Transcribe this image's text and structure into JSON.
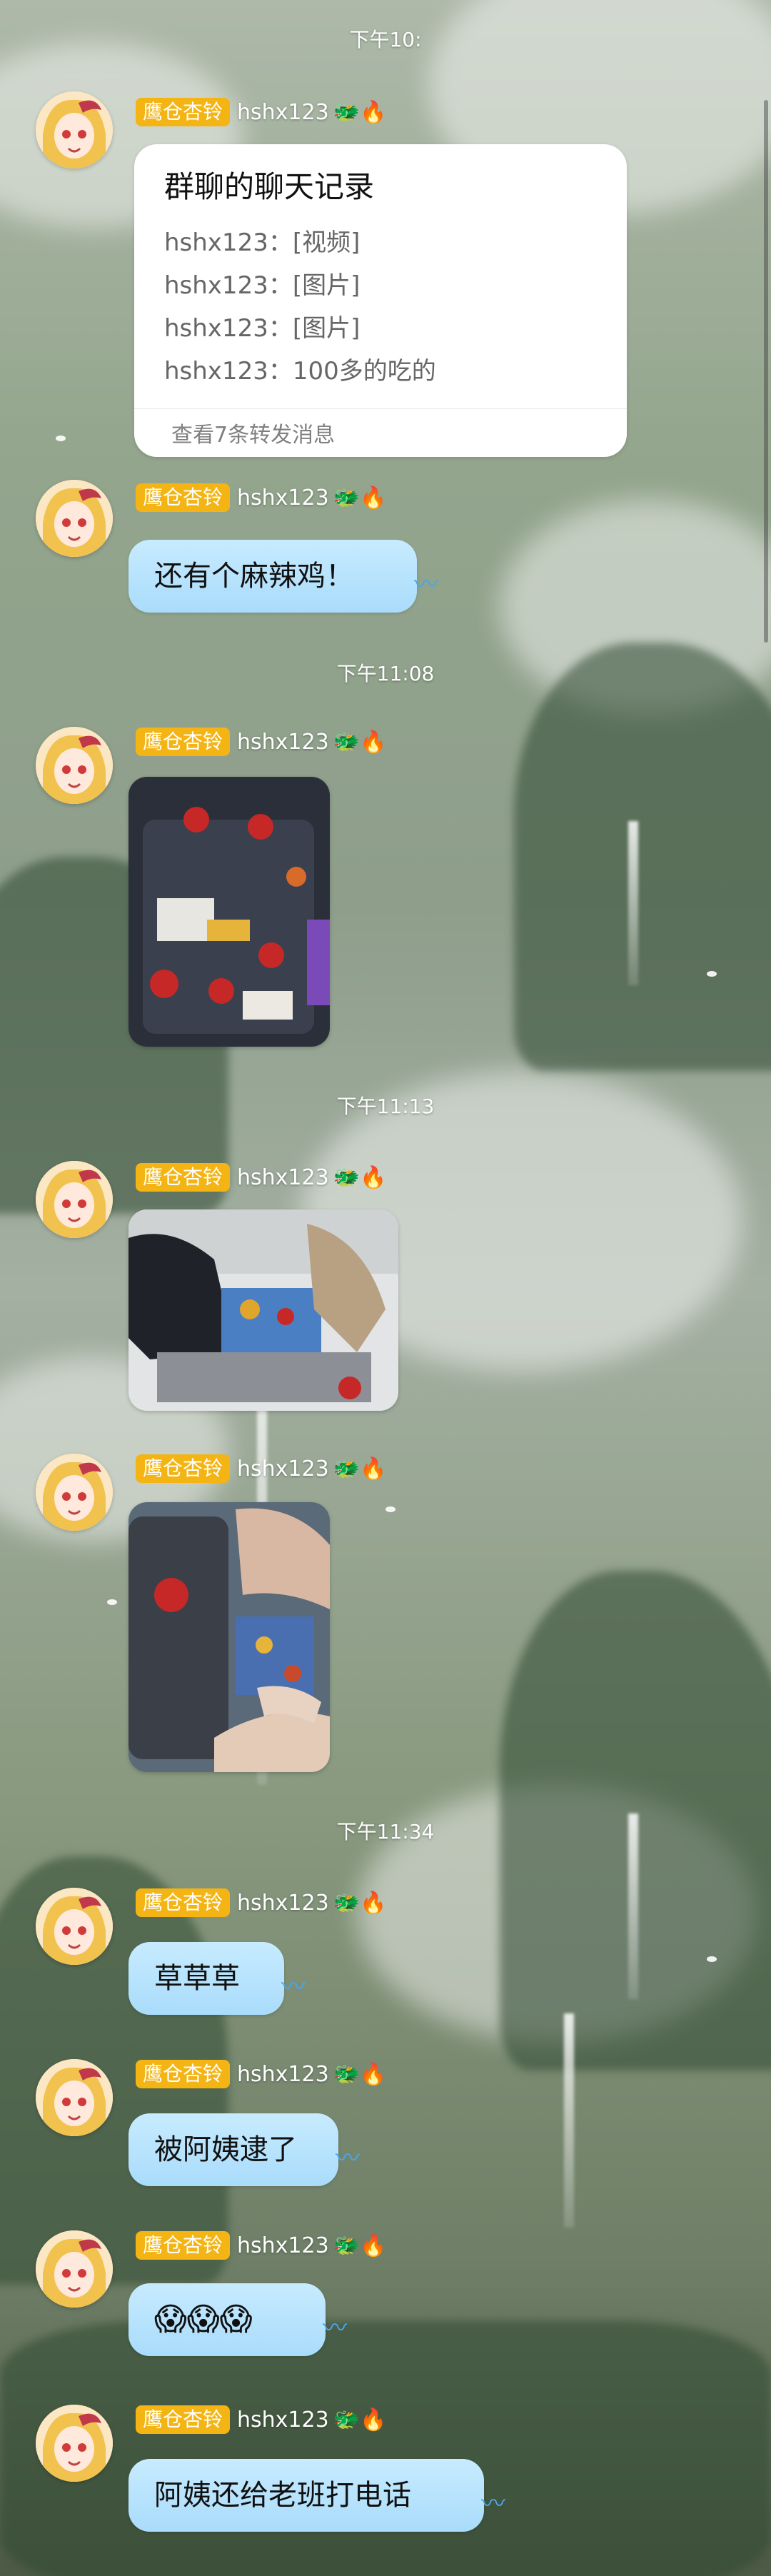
{
  "background": {
    "theme": "anime-waterfall-scenery"
  },
  "colors": {
    "tag_bg": "#f3b414",
    "bubble": "#b8e2fd",
    "card": "#ffffff"
  },
  "sender_tag": "鹰仓杏铃",
  "sender_name": "hshx123",
  "sender_emojis": "🐲🔥",
  "timestamps": {
    "t1": "下午10:",
    "t2": "下午11:08",
    "t3": "下午11:13",
    "t4": "下午11:34"
  },
  "forward_card": {
    "title": "群聊的聊天记录",
    "lines": [
      "hshx123：[视频]",
      "hshx123：[图片]",
      "hshx123：[图片]",
      "hshx123：100多的吃的"
    ],
    "footer": "查看7条转发消息"
  },
  "messages": {
    "m2": "还有个麻辣鸡！",
    "m6": "草草草",
    "m7": "被阿姨逮了",
    "m8": "😱😱😱",
    "m9": "阿姨还给老班打电话"
  },
  "photos": {
    "p1": {
      "description_icon": "image-icon",
      "watermark": ""
    },
    "p2": {
      "description_icon": "image-icon",
      "watermark": ""
    },
    "p3": {
      "description_icon": "image-icon",
      "watermark": ""
    }
  }
}
